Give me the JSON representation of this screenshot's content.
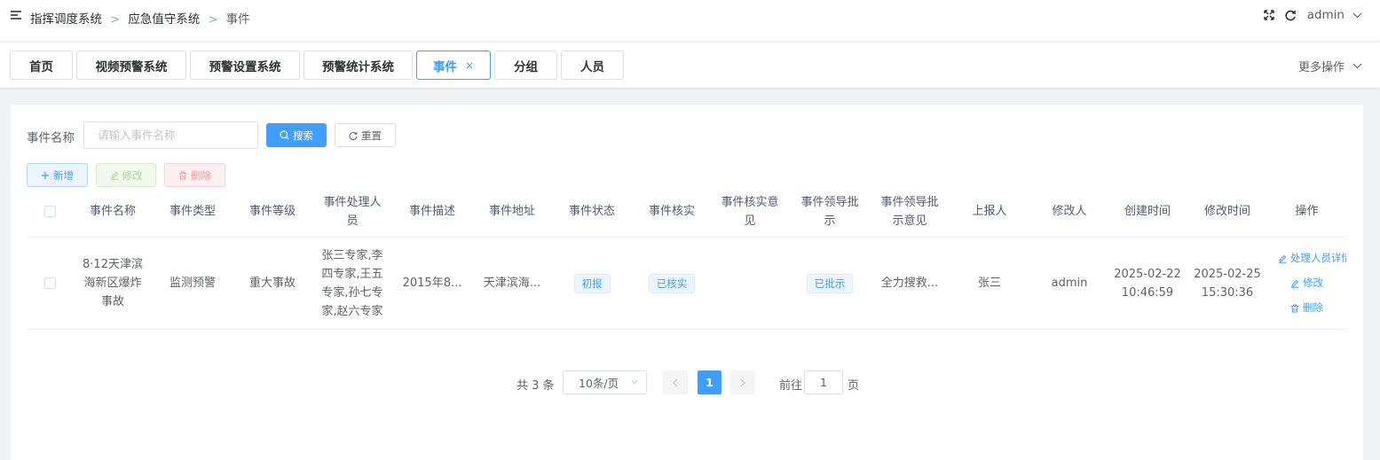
{
  "breadcrumb": [
    "指挥调度系统",
    "应急值守系统",
    "事件"
  ],
  "breadcrumb_sep": ">",
  "user": {
    "name": "admin"
  },
  "tabs": [
    {
      "label": "首页",
      "active": false
    },
    {
      "label": "视频预警系统",
      "active": false
    },
    {
      "label": "预警设置系统",
      "active": false
    },
    {
      "label": "预警统计系统",
      "active": false
    },
    {
      "label": "事件",
      "active": true,
      "close": "×"
    },
    {
      "label": "分组",
      "active": false
    },
    {
      "label": "人员",
      "active": false
    }
  ],
  "more_ops": "更多操作",
  "search": {
    "label": "事件名称",
    "placeholder": "请输入事件名称",
    "search_button": "搜索",
    "reset_button": "重置"
  },
  "toolbar": {
    "add": "新增",
    "edit": "修改",
    "delete": "删除"
  },
  "table": {
    "columns": [
      "事件名称",
      "事件类型",
      "事件等级",
      "事件处理人员",
      "事件描述",
      "事件地址",
      "事件状态",
      "事件核实",
      "事件核实意见",
      "事件领导批示",
      "事件领导批示意见",
      "上报人",
      "修改人",
      "创建时间",
      "修改时间",
      "操作"
    ],
    "rows": [
      {
        "name": "8·12天津滨海新区爆炸事故",
        "type": "监测预警",
        "level": "重大事故",
        "handlers": "张三专家,李四专家,王五专家,孙七专家,赵六专家",
        "description": "2015年8...",
        "address": "天津滨海...",
        "status": "初报",
        "verify": "已核实",
        "verify_opinion": "",
        "leader_instruction": "已批示",
        "leader_opinion": "全力搜救...",
        "reporter": "张三",
        "modifier": "admin",
        "created_date": "2025-02-22",
        "created_time": "10:46:59",
        "modified_date": "2025-02-25",
        "modified_time": "15:30:36",
        "ops": [
          "处理人员详情",
          "修改",
          "删除"
        ]
      }
    ]
  },
  "pagination": {
    "total": "共 3 条",
    "page_size": "10条/页",
    "current": "1",
    "goto_label": "前往",
    "goto_value": "1",
    "page_suffix": "页"
  },
  "colors": {
    "primary": "#409eff",
    "success": "#67c23a",
    "danger": "#f56c6c"
  }
}
